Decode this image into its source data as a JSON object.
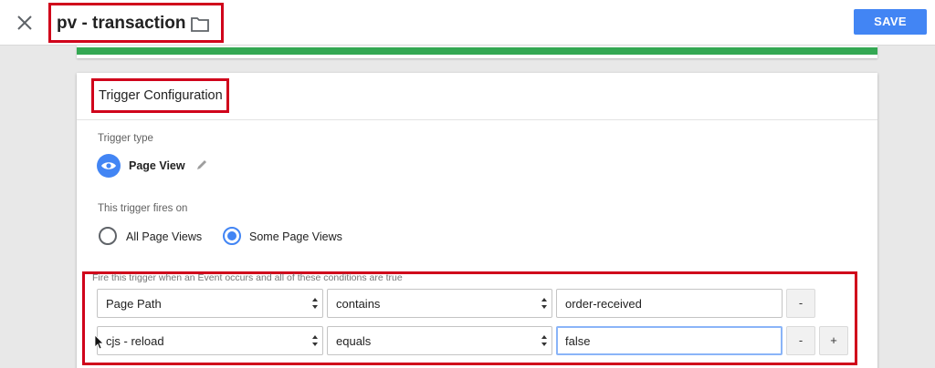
{
  "header": {
    "title": "pv - transaction",
    "save_label": "SAVE"
  },
  "card": {
    "title": "Trigger Configuration",
    "trigger_type_label": "Trigger type",
    "trigger_type_name": "Page View",
    "fires_on_label": "This trigger fires on",
    "options": [
      {
        "label": "All Page Views",
        "checked": false
      },
      {
        "label": "Some Page Views",
        "checked": true
      }
    ],
    "conditions_caption": "Fire this trigger when an Event occurs and all of these conditions are true",
    "conditions": [
      {
        "variable": "Page Path",
        "operator": "contains",
        "value": "order-received"
      },
      {
        "variable": "cjs - reload",
        "operator": "equals",
        "value": "false"
      }
    ],
    "remove_label": "-",
    "add_label": "+"
  },
  "colors": {
    "accent": "#4285f4",
    "highlight": "#d0021b",
    "success": "#34a853"
  },
  "icons": [
    "close-icon",
    "folder-icon",
    "eye-icon",
    "pencil-icon",
    "select-arrows-icon",
    "cursor-icon"
  ]
}
